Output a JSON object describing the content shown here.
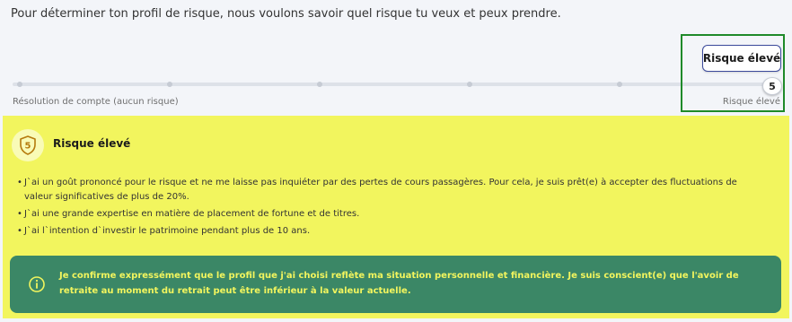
{
  "intro": "Pour déterminer ton profil de risque, nous voulons savoir quel risque tu veux et peux prendre.",
  "slider": {
    "tooltip": "Risque élevé",
    "value": "5",
    "min_label": "Résolution de compte (aucun risque)",
    "max_label": "Risque élevé"
  },
  "profile": {
    "badge_number": "5",
    "title": "Risque élevé",
    "bullets": [
      "J`ai un goût prononcé pour le risque et ne me laisse pas inquiéter par des pertes de cours passagères. Pour cela, je suis prêt(e) à accepter des fluctuations de valeur significatives de plus de 20%.",
      "J`ai une grande expertise en matière de placement de fortune et de titres.",
      "J`ai l`intention d`investir le patrimoine pendant plus de 10 ans."
    ]
  },
  "confirmation": "Je confirme expressément que le profil que j'ai choisi reflète ma situation personnelle et financière. Je suis conscient(e) que l'avoir de retraite au moment du retrait peut être inférieur à la valeur actuelle.",
  "colors": {
    "panel_bg": "#f2f55e",
    "confirm_bg": "#3b8766",
    "accent_text": "#f2f55e",
    "highlight_border": "#1f8a2a"
  },
  "icons": {
    "badge": "shield-number-icon",
    "info": "info-circle-icon"
  }
}
